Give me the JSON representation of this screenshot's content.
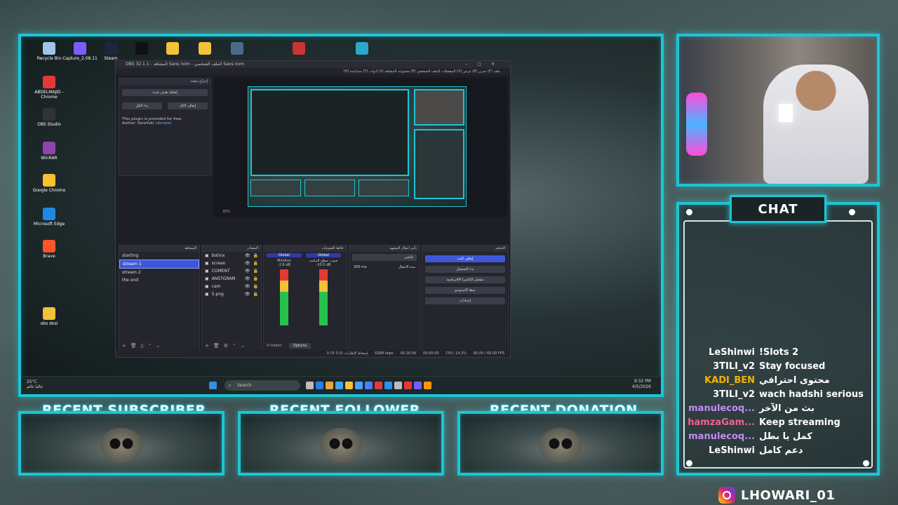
{
  "desktop": {
    "icons": [
      {
        "label": "Recycle Bin",
        "color": "#9ec5e8"
      },
      {
        "label": "Capture_2.08.11",
        "color": "#7a5cff"
      },
      {
        "label": "Steam",
        "color": "#1b2838"
      },
      {
        "label": "",
        "color": "#111111"
      },
      {
        "label": "",
        "color": "#f2c23a"
      },
      {
        "label": "",
        "color": "#f2c23a"
      },
      {
        "label": "",
        "color": "#4a6a88"
      },
      {
        "label": "",
        "color": "#c33"
      },
      {
        "label": "",
        "color": "#2aa7c9"
      },
      {
        "label": "ABDELMAJID - Chrome",
        "color": "#e53935"
      },
      {
        "label": "OBS Studio",
        "color": "#333"
      },
      {
        "label": "WinRAR",
        "color": "#8e44ad"
      },
      {
        "label": "Google Chrome",
        "color": "#fbc02d"
      },
      {
        "label": "Microsoft Edge",
        "color": "#1e88e5"
      },
      {
        "label": "Brave",
        "color": "#fb542b"
      },
      {
        "label": "obs dosi",
        "color": "#f2c23a"
      }
    ],
    "taskbar": {
      "weather_temp": "25°C",
      "weather_desc": "غالبا غائم",
      "search_placeholder": "Search",
      "time": "9:32 PM",
      "date": "4/5/2026",
      "lang": "ENG"
    }
  },
  "obs": {
    "title": "OBS 32.1.1 - المشاهد Sans nom - الملف الشخصي Sans nom",
    "menu": "ملف (F)   تحرير (E)   عرض (V)   المفضلات   الملف الشخصي (P)   مجموعة المشاهد (S)   أدوات (T)   مساعدة (H)",
    "plugin_dock_title": "إخراج متعدد",
    "plugin_add_target": "إضافة هدف جديد",
    "plugin_start_all": "بدء الكل",
    "plugin_stop_all": "إيقاف الكل",
    "plugin_note1": "This plugin is provided for free.",
    "plugin_note2": "Author: SoraYuki",
    "plugin_donate": "(donate)",
    "preview_zoom": "35%",
    "scenes_title": "المشاهد",
    "scenes": [
      "starting",
      "stream 1",
      "stream 2",
      "the end"
    ],
    "selected_scene": "stream 1",
    "sources_title": "المصادر",
    "sources": [
      "botnix",
      "screan",
      "COMENT",
      "ANSTGRAM",
      "cam",
      "5.png"
    ],
    "mixer_title": "خالط الصوتيات",
    "mixer_tracks": [
      {
        "name": "Global",
        "label": "Mic/Aux",
        "level": "-2.6 dB"
      },
      {
        "name": "Global",
        "label": "صوت سطح المكتب",
        "level": "-10.0 dB"
      }
    ],
    "transitions_title": "تأثير انتقال المشهد",
    "transition": "تلاشي",
    "duration_label": "مدة الانتقال",
    "duration": "300 ms",
    "controls_title": "التحكم",
    "controls": [
      "إيقاف البث",
      "بدء التسجيل",
      "تشغيل الكاميرا الافتراضية",
      "نمط الاستوديو",
      "إعدادات"
    ],
    "hidden_label": "0 hidden",
    "options_label": "Options",
    "status": {
      "dropped": "إسقاط الإطارات (0.0 %) 0",
      "kbps": "6288 kbps",
      "live_time": "00:16:06",
      "rec_time": "00:00:00",
      "cpu": "CPU: 14.3%",
      "fps": "60.00 / 60.00 FPS"
    }
  },
  "overlay": {
    "chat_title": "CHAT",
    "recent_subscriber": "RECENT SUBSCRIBER",
    "recent_follower": "RECENT FOLLOWER",
    "recent_donation": "RECENT DONATION",
    "handle": "LHOWARI_01",
    "accent_color": "#1fc4d2",
    "chat_messages": [
      {
        "user": "LeShinwi",
        "msg": "!Slots 2",
        "color": "#ffffff"
      },
      {
        "user": "3TILI_v2",
        "msg": "Stay focused",
        "color": "#ffffff"
      },
      {
        "user": "KADI_BEN",
        "msg": "محتوى احترافي",
        "color": "#f4b400"
      },
      {
        "user": "3TILI_v2",
        "msg": "wach hadshi serious",
        "color": "#ffffff"
      },
      {
        "user": "manulecoq...",
        "msg": "بث من الآخر",
        "color": "#c58bf2"
      },
      {
        "user": "hamzaGam...",
        "msg": "Keep streaming",
        "color": "#f06292"
      },
      {
        "user": "manulecoq...",
        "msg": "كمل يا بطل",
        "color": "#c58bf2"
      },
      {
        "user": "LeShinwi",
        "msg": "دعم كامل",
        "color": "#ffffff"
      }
    ]
  }
}
